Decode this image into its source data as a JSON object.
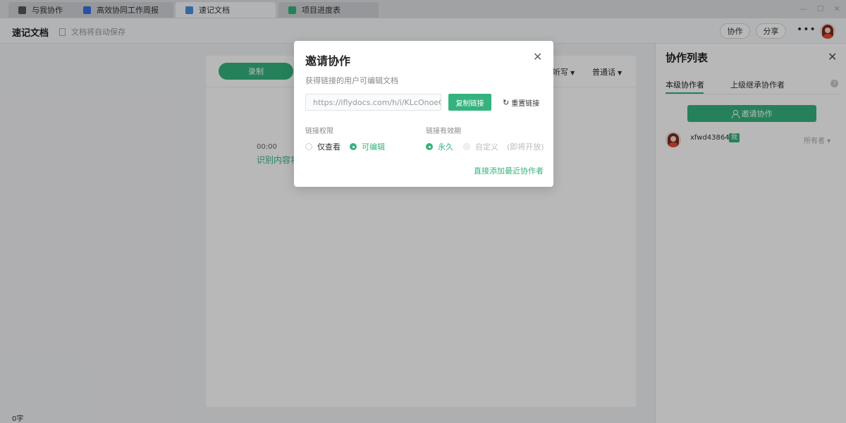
{
  "tabs": [
    {
      "label": "与我协作",
      "icon": "cube-icon",
      "color": "#555555"
    },
    {
      "label": "高效协同工作周报",
      "icon": "doc-icon",
      "color": "#3b6fe0"
    },
    {
      "label": "速记文档",
      "icon": "note-icon",
      "color": "#4a90e2"
    },
    {
      "label": "项目进度表",
      "icon": "sheet-icon",
      "color": "#35b37e"
    }
  ],
  "header": {
    "title": "速记文档",
    "save_status": "文档将自动保存",
    "collab_label": "协作",
    "share_label": "分享",
    "more_label": "•••"
  },
  "editor": {
    "record_label": "录制",
    "mode_label": "听写",
    "accent_label": "普通话",
    "timestamp": "00:00",
    "placeholder": "识别内容将"
  },
  "panel": {
    "title": "协作列表",
    "close_label": "✕",
    "tab_current": "本级协作者",
    "tab_inherited": "上级继承协作者",
    "help_label": "?",
    "invite_label": "邀请协作",
    "member_name": "xfwd438647",
    "me_badge": "我",
    "owner_label": "所有者 ▾"
  },
  "footer": {
    "word_count": "0字"
  },
  "modal": {
    "title": "邀请协作",
    "close_label": "✕",
    "subtitle": "获得链接的用户可编辑文档",
    "link_value": "https://iflydocs.com/h/i/KLcOnoeOm",
    "copy_label": "复制链接",
    "reset_label": "重置链接",
    "permission_label": "链接权限",
    "perm_view": "仅查看",
    "perm_edit": "可编辑",
    "validity_label": "链接有效期",
    "valid_forever": "永久",
    "valid_custom": "自定义",
    "coming_soon": "(即将开放)",
    "direct_add": "直接添加最近协作者"
  },
  "colors": {
    "accent": "#35b37e"
  }
}
